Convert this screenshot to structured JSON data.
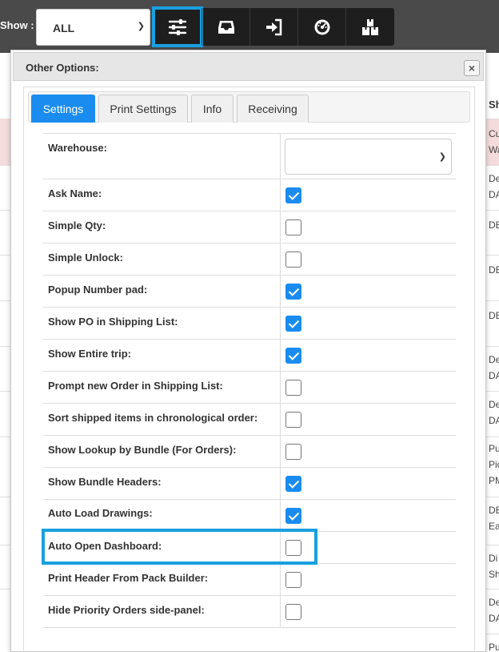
{
  "toolbar": {
    "show_label": "Show :",
    "show_value": "ALL",
    "buttons": [
      {
        "icon": "sliders-icon",
        "active": true
      },
      {
        "icon": "inbox-icon",
        "active": false
      },
      {
        "icon": "sign-in-icon",
        "active": false
      },
      {
        "icon": "dashboard-icon",
        "active": false
      },
      {
        "icon": "boxes-icon",
        "active": false
      }
    ]
  },
  "background": {
    "right_header": "Sh",
    "right_rows": [
      "Cu",
      "Wa",
      "De",
      "DA",
      "DE",
      "DE",
      "DE",
      "De",
      "DA",
      "De",
      "DA",
      "Pu",
      "Pic",
      "PM",
      "DE",
      "Ea",
      "Di",
      "Sh",
      "De",
      "DA",
      "Pu"
    ]
  },
  "modal": {
    "title": "Other Options:",
    "close_label": "×",
    "tabs": [
      {
        "label": "Settings",
        "active": true
      },
      {
        "label": "Print Settings",
        "active": false
      },
      {
        "label": "Info",
        "active": false
      },
      {
        "label": "Receiving",
        "active": false
      }
    ],
    "warehouse": {
      "label": "Warehouse:",
      "value": ""
    },
    "settings": [
      {
        "label": "Ask Name:",
        "checked": true
      },
      {
        "label": "Simple Qty:",
        "checked": false
      },
      {
        "label": "Simple Unlock:",
        "checked": false
      },
      {
        "label": "Popup Number pad:",
        "checked": true
      },
      {
        "label": "Show PO in Shipping List:",
        "checked": true
      },
      {
        "label": "Show Entire trip:",
        "checked": true
      },
      {
        "label": "Prompt new Order in Shipping List:",
        "checked": false
      },
      {
        "label": "Sort shipped items in chronological order:",
        "checked": false
      },
      {
        "label": "Show Lookup by Bundle (For Orders):",
        "checked": false
      },
      {
        "label": "Show Bundle Headers:",
        "checked": true
      },
      {
        "label": "Auto Load Drawings:",
        "checked": true
      },
      {
        "label": "Auto Open Dashboard:",
        "checked": false
      },
      {
        "label": "Print Header From Pack Builder:",
        "checked": false
      },
      {
        "label": "Hide Priority Orders side-panel:",
        "checked": false
      }
    ]
  },
  "colors": {
    "accent": "#1a8cf0",
    "highlight": "#1a9fe0",
    "toolbar": "#4a4a4a"
  }
}
